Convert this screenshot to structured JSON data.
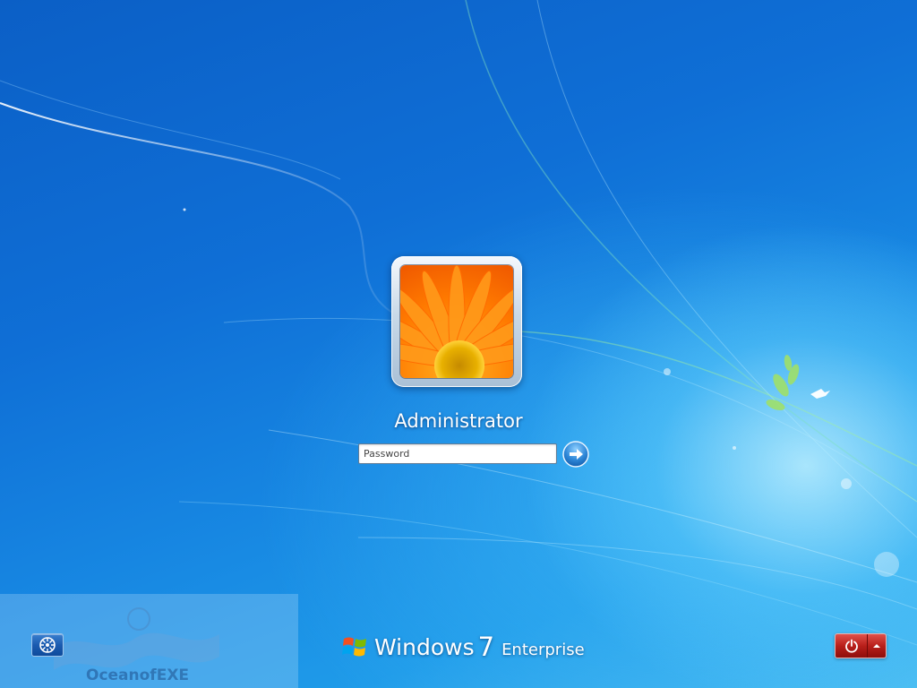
{
  "user": {
    "name": "Administrator"
  },
  "password": {
    "placeholder": "Password"
  },
  "branding": {
    "windows": "Windows",
    "version": "7",
    "edition": "Enterprise"
  },
  "watermark": {
    "text": "OceanofEXE"
  },
  "icons": {
    "submit": "arrow-right-icon",
    "ease_of_access": "ease-of-access-icon",
    "power": "power-icon",
    "options": "caret-up-icon",
    "logo": "windows-logo-icon"
  },
  "colors": {
    "background": "#1a7fdc",
    "power_red": "#b81f1a",
    "ease_blue": "#1b5bb0"
  }
}
